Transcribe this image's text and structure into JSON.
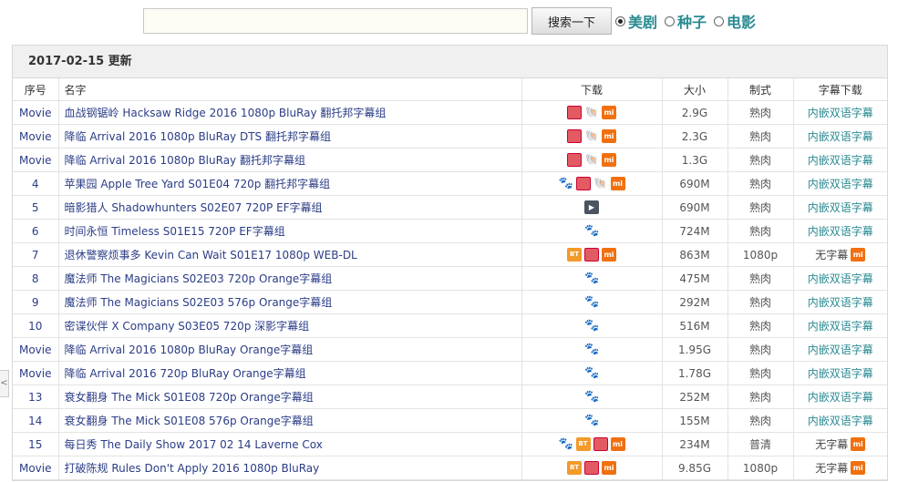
{
  "search": {
    "placeholder": "",
    "value": "",
    "button_label": "搜索一下"
  },
  "filters": [
    {
      "label": "美剧",
      "checked": true
    },
    {
      "label": "种子",
      "checked": false
    },
    {
      "label": "电影",
      "checked": false
    }
  ],
  "panel": {
    "title": "2017-02-15 更新"
  },
  "table": {
    "headers": {
      "seq": "序号",
      "name": "名字",
      "download": "下载",
      "size": "大小",
      "format": "制式",
      "subtitle": "字幕下载"
    },
    "rows": [
      {
        "seq": "Movie",
        "name": "血战钢锯岭 Hacksaw Ridge 2016 1080p BluRay 翻托邦字幕组",
        "icons": [
          "ed2k",
          "magnet",
          "mi"
        ],
        "size": "2.9G",
        "format": "熟肉",
        "subtitle": "内嵌双语字幕",
        "sub_icon": false
      },
      {
        "seq": "Movie",
        "name": "降临 Arrival 2016 1080p BluRay DTS 翻托邦字幕组",
        "icons": [
          "ed2k",
          "magnet",
          "mi"
        ],
        "size": "2.3G",
        "format": "熟肉",
        "subtitle": "内嵌双语字幕",
        "sub_icon": false
      },
      {
        "seq": "Movie",
        "name": "降临 Arrival 2016 1080p BluRay 翻托邦字幕组",
        "icons": [
          "ed2k",
          "magnet",
          "mi"
        ],
        "size": "1.3G",
        "format": "熟肉",
        "subtitle": "内嵌双语字幕",
        "sub_icon": false
      },
      {
        "seq": "4",
        "name": "苹果园 Apple Tree Yard S01E04 720p 翻托邦字幕组",
        "icons": [
          "baidu",
          "ed2k",
          "magnet",
          "mi"
        ],
        "size": "690M",
        "format": "熟肉",
        "subtitle": "内嵌双语字幕",
        "sub_icon": false
      },
      {
        "seq": "5",
        "name": "暗影猎人 Shadowhunters S02E07 720P EF字幕组",
        "icons": [
          "play"
        ],
        "size": "690M",
        "format": "熟肉",
        "subtitle": "内嵌双语字幕",
        "sub_icon": false
      },
      {
        "seq": "6",
        "name": "时间永恒 Timeless S01E15 720P EF字幕组",
        "icons": [
          "baidu"
        ],
        "size": "724M",
        "format": "熟肉",
        "subtitle": "内嵌双语字幕",
        "sub_icon": false
      },
      {
        "seq": "7",
        "name": "退休警察烦事多 Kevin Can Wait S01E17 1080p WEB-DL",
        "icons": [
          "bt",
          "ed2k",
          "mi"
        ],
        "size": "863M",
        "format": "1080p",
        "subtitle": "无字幕",
        "sub_icon": true
      },
      {
        "seq": "8",
        "name": "魔法师 The Magicians S02E03 720p Orange字幕组",
        "icons": [
          "baidu"
        ],
        "size": "475M",
        "format": "熟肉",
        "subtitle": "内嵌双语字幕",
        "sub_icon": false
      },
      {
        "seq": "9",
        "name": "魔法师 The Magicians S02E03 576p Orange字幕组",
        "icons": [
          "baidu"
        ],
        "size": "292M",
        "format": "熟肉",
        "subtitle": "内嵌双语字幕",
        "sub_icon": false
      },
      {
        "seq": "10",
        "name": "密谍伙伴 X Company S03E05 720p 深影字幕组",
        "icons": [
          "baidu"
        ],
        "size": "516M",
        "format": "熟肉",
        "subtitle": "内嵌双语字幕",
        "sub_icon": false
      },
      {
        "seq": "Movie",
        "name": "降临 Arrival 2016 1080p BluRay Orange字幕组",
        "icons": [
          "baidu"
        ],
        "size": "1.95G",
        "format": "熟肉",
        "subtitle": "内嵌双语字幕",
        "sub_icon": false
      },
      {
        "seq": "Movie",
        "name": "降临 Arrival 2016 720p BluRay Orange字幕组",
        "icons": [
          "baidu"
        ],
        "size": "1.78G",
        "format": "熟肉",
        "subtitle": "内嵌双语字幕",
        "sub_icon": false
      },
      {
        "seq": "13",
        "name": "衰女翻身 The Mick S01E08 720p Orange字幕组",
        "icons": [
          "baidu"
        ],
        "size": "252M",
        "format": "熟肉",
        "subtitle": "内嵌双语字幕",
        "sub_icon": false
      },
      {
        "seq": "14",
        "name": "衰女翻身 The Mick S01E08 576p Orange字幕组",
        "icons": [
          "baidu"
        ],
        "size": "155M",
        "format": "熟肉",
        "subtitle": "内嵌双语字幕",
        "sub_icon": false
      },
      {
        "seq": "15",
        "name": "每日秀 The Daily Show 2017 02 14 Laverne Cox",
        "icons": [
          "baidu",
          "bt",
          "ed2k",
          "mi"
        ],
        "size": "234M",
        "format": "普清",
        "subtitle": "无字幕",
        "sub_icon": true
      },
      {
        "seq": "Movie",
        "name": "打破陈规 Rules Don't Apply 2016 1080p BluRay",
        "icons": [
          "bt",
          "ed2k",
          "mi"
        ],
        "size": "9.85G",
        "format": "1080p",
        "subtitle": "无字幕",
        "sub_icon": true
      }
    ]
  },
  "icon_labels": {
    "ed2k": "",
    "magnet": "🐚",
    "mi": "mi",
    "bt": "BT",
    "baidu": "🐾",
    "play": "▶"
  },
  "colors": {
    "accent": "#2a8a92",
    "link": "#2b3d86",
    "mi": "#f07010",
    "bt": "#f39a2a",
    "ed2k": "#e25b62"
  }
}
